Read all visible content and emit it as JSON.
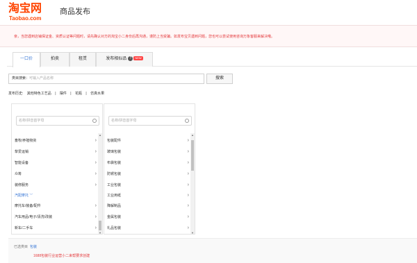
{
  "header": {
    "logo_cn": "淘宝网",
    "logo_en": "Taobao.com",
    "title": "商品发布"
  },
  "notice": {
    "text": "亲，当您遇到店铺保证金、资质认证等问题时，请先确认对方的淘宝小二身份后再沟通，谨防上当受骗。如发布宝贝遇到问题，您也可以尝试使用咨询万象客服来解决哦。"
  },
  "tabs": [
    {
      "label": "一口价"
    },
    {
      "label": "拍卖"
    },
    {
      "label": "租赁"
    },
    {
      "label": "发布相似品",
      "badge": "NEW",
      "help": "?"
    }
  ],
  "search": {
    "label": "类目搜索：",
    "placeholder": "可输入产品名称",
    "button": "搜索"
  },
  "history": {
    "label": "发布历史:",
    "items": [
      "其他特色工艺品",
      "摆件",
      "花瓶",
      "仿真水果"
    ]
  },
  "category_col1": {
    "filter_placeholder": "名称/拼音首字母",
    "items": [
      {
        "label": "畜牧/养殖物资"
      },
      {
        "label": "挚爱运销"
      },
      {
        "label": "智能设备"
      },
      {
        "label": "众筹"
      },
      {
        "label": "装修服务"
      },
      {
        "label": "汽配摩托",
        "group": true
      },
      {
        "label": "摩托车/装备/配件"
      },
      {
        "label": "汽车用品/电子/清洗/改装"
      },
      {
        "label": "新车/二手车"
      }
    ]
  },
  "category_col2": {
    "filter_placeholder": "名称/拼音首字母",
    "items": [
      {
        "label": "包装配件"
      },
      {
        "label": "玻璃包装"
      },
      {
        "label": "布袋包装"
      },
      {
        "label": "防锈包装"
      },
      {
        "label": "工业包装"
      },
      {
        "label": "工业用纸"
      },
      {
        "label": "降解制品"
      },
      {
        "label": "金属包装"
      },
      {
        "label": "礼品包装"
      }
    ]
  },
  "selected": {
    "label": "已选类目",
    "value": "包装",
    "note": "1688包装行业运营小二来帮要求创建"
  },
  "colors": {
    "brand": "#ff4400",
    "link": "#3a78d6",
    "warning": "#e4393c"
  }
}
